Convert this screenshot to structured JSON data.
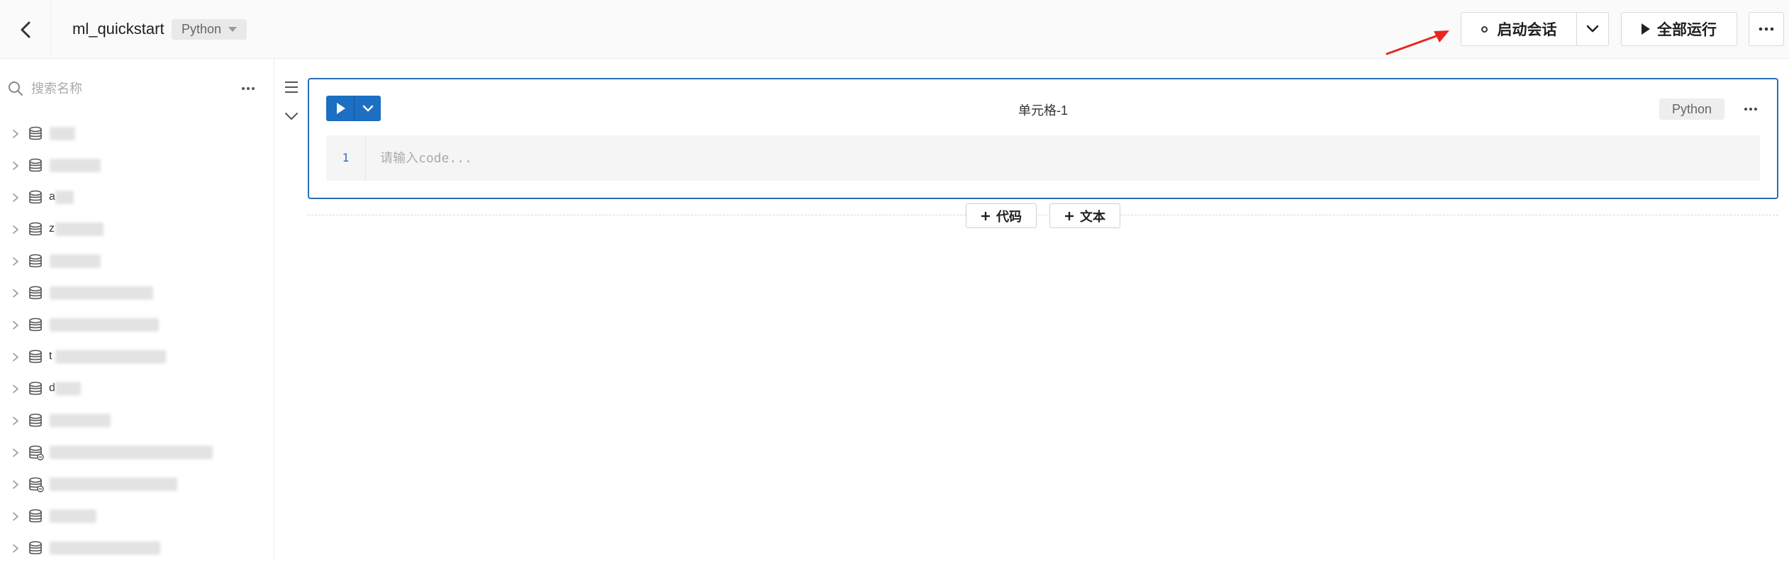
{
  "header": {
    "notebook_title": "ml_quickstart",
    "language_tag": "Python",
    "start_session_label": "启动会话",
    "run_all_label": "全部运行"
  },
  "sidebar": {
    "search_placeholder": "搜索名称",
    "items": [
      {
        "label": "",
        "icon": "database-icon"
      },
      {
        "label": "",
        "icon": "database-icon"
      },
      {
        "label": "a",
        "icon": "database-icon"
      },
      {
        "label": "z",
        "icon": "database-icon"
      },
      {
        "label": "",
        "icon": "database-icon"
      },
      {
        "label": "",
        "icon": "database-icon"
      },
      {
        "label": "",
        "icon": "database-icon"
      },
      {
        "label": "t",
        "icon": "database-icon"
      },
      {
        "label": "d",
        "icon": "database-icon"
      },
      {
        "label": "",
        "icon": "database-icon"
      },
      {
        "label": "",
        "icon": "database-link-icon"
      },
      {
        "label": "",
        "icon": "database-link-icon"
      },
      {
        "label": "",
        "icon": "database-icon"
      },
      {
        "label": "",
        "icon": "database-icon"
      }
    ]
  },
  "cell": {
    "title": "单元格-1",
    "language": "Python",
    "line_number": "1",
    "code_placeholder": "请输入code..."
  },
  "add_buttons": {
    "code_label": "代码",
    "text_label": "文本"
  },
  "colors": {
    "accent": "#1c6fc2",
    "cell_border": "#2a6db5",
    "annotation_arrow": "#e8261f"
  }
}
